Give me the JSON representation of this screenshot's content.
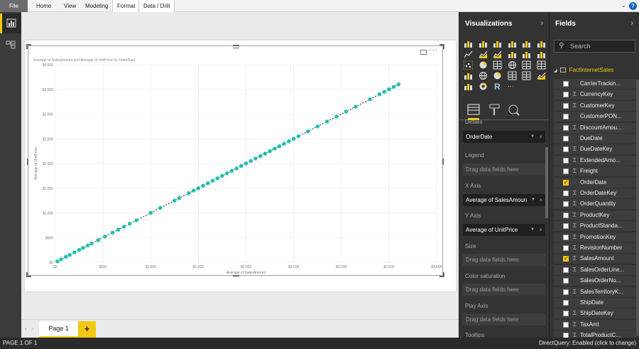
{
  "ribbon": {
    "file": "File",
    "tabs": [
      "Home",
      "View",
      "Modeling",
      "Format",
      "Data / Drill"
    ],
    "help": "?"
  },
  "chart_data": {
    "type": "scatter",
    "title": "Average of SalesAmount and Average of UnitPrice by OrderDate",
    "xlabel": "Average of SalesAmount",
    "ylabel": "Average of UnitPrice",
    "xlim": [
      0,
      4000
    ],
    "ylim": [
      0,
      4000
    ],
    "xticks": [
      "$0",
      "$500",
      "$1,000",
      "$1,500",
      "$2,000",
      "$2,500",
      "$3,000",
      "$3,500",
      "$4,000"
    ],
    "yticks": [
      "$0",
      "$500",
      "$1,000",
      "$1,500",
      "$2,000",
      "$2,500",
      "$3,000",
      "$3,500",
      "$4,000"
    ],
    "color": "#01b8aa",
    "trend_line": true,
    "x": [
      20,
      60,
      110,
      150,
      200,
      250,
      290,
      340,
      380,
      450,
      520,
      600,
      660,
      720,
      780,
      850,
      1000,
      1100,
      1250,
      1300,
      1400,
      1450,
      1500,
      1550,
      1600,
      1650,
      1700,
      1750,
      1800,
      1850,
      1900,
      1950,
      2000,
      2050,
      2100,
      2150,
      2200,
      2250,
      2300,
      2350,
      2400,
      2450,
      2500,
      2550,
      2650,
      2750,
      2850,
      2950,
      3050,
      3150,
      3300,
      3400,
      3450,
      3500,
      3550,
      3600
    ],
    "y": [
      20,
      60,
      110,
      150,
      200,
      250,
      290,
      340,
      380,
      450,
      520,
      600,
      660,
      720,
      780,
      850,
      1000,
      1100,
      1250,
      1300,
      1400,
      1450,
      1500,
      1550,
      1600,
      1650,
      1700,
      1750,
      1800,
      1850,
      1900,
      1950,
      2000,
      2050,
      2100,
      2150,
      2200,
      2250,
      2300,
      2350,
      2400,
      2450,
      2500,
      2550,
      2650,
      2750,
      2850,
      2950,
      3050,
      3150,
      3300,
      3400,
      3450,
      3500,
      3550,
      3600
    ]
  },
  "pages": {
    "tabs": [
      "Page 1"
    ],
    "add": "+"
  },
  "status": {
    "page": "PAGE 1 OF 1",
    "mode": "DirectQuery: Enabled (click to change)"
  },
  "viz": {
    "title": "Visualizations",
    "sections": {
      "details": "Details",
      "legend": "Legend",
      "xaxis": "X Axis",
      "yaxis": "Y Axis",
      "size": "Size",
      "saturation": "Color saturation",
      "playaxis": "Play Axis",
      "tooltips": "Tooltips"
    },
    "details_value": "OrderDate",
    "x_value": "Average of SalesAmoun",
    "y_value": "Average of UnitPrice",
    "placeholder": "Drag data fields here",
    "more": "···",
    "r_label": "R"
  },
  "fields": {
    "title": "Fields",
    "search": "Search",
    "table": "FactInternetSales",
    "items": [
      {
        "name": "CarrierTrackin...",
        "sigma": false,
        "checked": false
      },
      {
        "name": "CurrencyKey",
        "sigma": true,
        "checked": false
      },
      {
        "name": "CustomerKey",
        "sigma": true,
        "checked": false
      },
      {
        "name": "CustomerPON...",
        "sigma": false,
        "checked": false
      },
      {
        "name": "DiscountAmou...",
        "sigma": true,
        "checked": false
      },
      {
        "name": "DueDate",
        "sigma": false,
        "checked": false
      },
      {
        "name": "DueDateKey",
        "sigma": true,
        "checked": false
      },
      {
        "name": "ExtendedAmo...",
        "sigma": true,
        "checked": false
      },
      {
        "name": "Freight",
        "sigma": true,
        "checked": false
      },
      {
        "name": "OrderDate",
        "sigma": false,
        "checked": true
      },
      {
        "name": "OrderDateKey",
        "sigma": true,
        "checked": false
      },
      {
        "name": "OrderQuantity",
        "sigma": true,
        "checked": false
      },
      {
        "name": "ProductKey",
        "sigma": true,
        "checked": false
      },
      {
        "name": "ProductStanda...",
        "sigma": true,
        "checked": false
      },
      {
        "name": "PromotionKey",
        "sigma": true,
        "checked": false
      },
      {
        "name": "RevisionNumber",
        "sigma": true,
        "checked": false
      },
      {
        "name": "SalesAmount",
        "sigma": true,
        "checked": true
      },
      {
        "name": "SalesOrderLine...",
        "sigma": true,
        "checked": false
      },
      {
        "name": "SalesOrderNu...",
        "sigma": false,
        "checked": false
      },
      {
        "name": "SalesTerritoryK...",
        "sigma": true,
        "checked": false
      },
      {
        "name": "ShipDate",
        "sigma": false,
        "checked": false
      },
      {
        "name": "ShipDateKey",
        "sigma": true,
        "checked": false
      },
      {
        "name": "TaxAmt",
        "sigma": true,
        "checked": false
      },
      {
        "name": "TotalProductC...",
        "sigma": true,
        "checked": false
      }
    ]
  },
  "sigma_glyph": "Σ"
}
